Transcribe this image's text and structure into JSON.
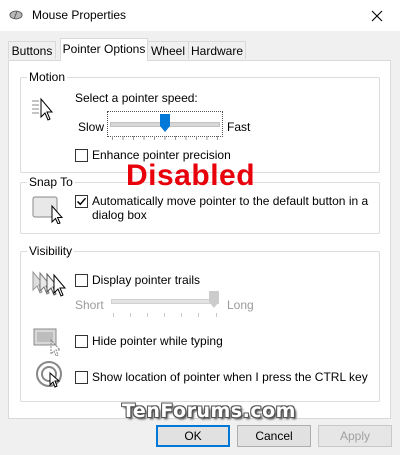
{
  "window": {
    "title": "Mouse Properties",
    "close_glyph": "✕"
  },
  "tabs": [
    {
      "label": "Buttons"
    },
    {
      "label": "Pointer Options",
      "active": true
    },
    {
      "label": "Wheel"
    },
    {
      "label": "Hardware"
    }
  ],
  "motion": {
    "group_label": "Motion",
    "speed_label": "Select a pointer speed:",
    "slow_label": "Slow",
    "fast_label": "Fast",
    "speed_value_fraction": 0.5,
    "enhance_label": "Enhance pointer precision",
    "enhance_checked": false
  },
  "overlay": {
    "text": "Disabled",
    "color": "#e8000b"
  },
  "snap_to": {
    "group_label": "Snap To",
    "auto_move_label_line1": "Automatically move pointer to the default button in a",
    "auto_move_label_line2": "dialog box",
    "auto_move_checked": true
  },
  "visibility": {
    "group_label": "Visibility",
    "trails_label": "Display pointer trails",
    "trails_checked": false,
    "short_label": "Short",
    "long_label": "Long",
    "trails_value_fraction": 1.0,
    "hide_label": "Hide pointer while typing",
    "hide_checked": false,
    "show_ctrl_label": "Show location of pointer when I press the CTRL key",
    "show_ctrl_checked": false
  },
  "buttons": {
    "ok": "OK",
    "cancel": "Cancel",
    "apply": "Apply"
  },
  "watermark": "TenForums.com",
  "colors": {
    "accent": "#0078d7",
    "overlay_red": "#e8000b"
  }
}
